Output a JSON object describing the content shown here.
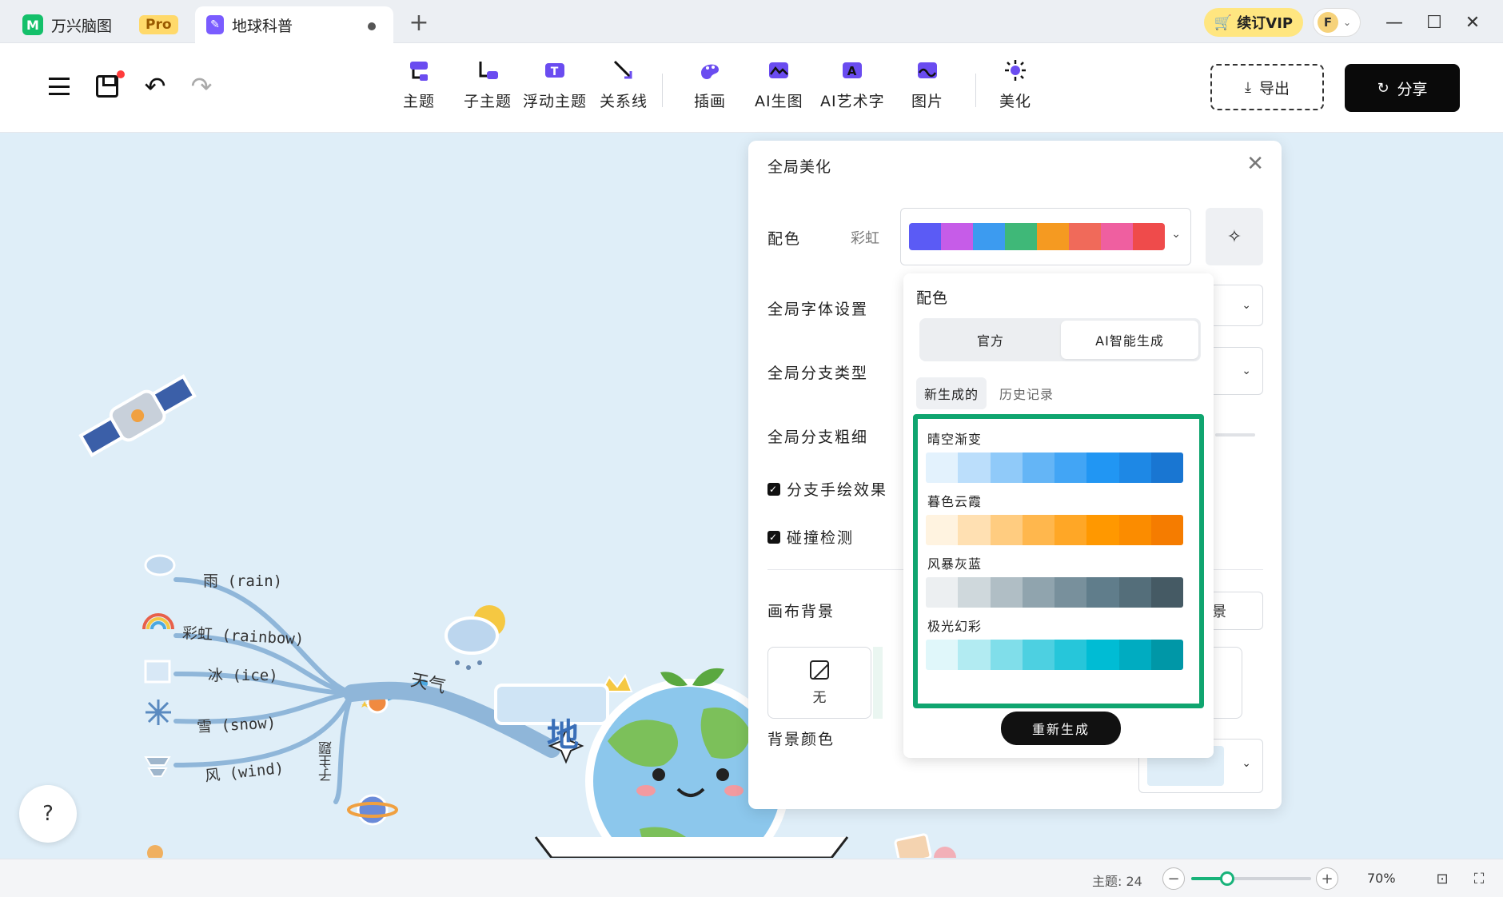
{
  "titlebar": {
    "app_name": "万兴脑图",
    "pro_badge": "Pro",
    "doc_tab": "地球科普",
    "vip_button": "续订VIP",
    "avatar_letter": "F"
  },
  "toolbar": {
    "tools": [
      {
        "label": "主题",
        "icon": "topic-icon"
      },
      {
        "label": "子主题",
        "icon": "subtopic-icon"
      },
      {
        "label": "浮动主题",
        "icon": "floating-topic-icon"
      },
      {
        "label": "关系线",
        "icon": "relation-line-icon"
      },
      {
        "label": "插画",
        "icon": "illustration-icon"
      },
      {
        "label": "AI生图",
        "icon": "ai-image-icon"
      },
      {
        "label": "AI艺术字",
        "icon": "ai-art-text-icon"
      },
      {
        "label": "图片",
        "icon": "picture-icon"
      },
      {
        "label": "美化",
        "icon": "beautify-icon"
      }
    ],
    "export_label": "导出",
    "share_label": "分享"
  },
  "mindmap": {
    "central": "地",
    "weather_branch": "天气",
    "subtopic_label": "子主题",
    "leaves": [
      "雨 (rain)",
      "彩虹 (rainbow)",
      "冰 (ice)",
      "雪 (snow)",
      "风 (wind)"
    ]
  },
  "panel": {
    "title": "全局美化",
    "color_label": "配色",
    "scheme_name": "彩虹",
    "scheme_colors": [
      "#5b5bf5",
      "#c65ce8",
      "#3c9bf0",
      "#3fb878",
      "#f59a21",
      "#f06a5a",
      "#ef5fa0",
      "#ef4b4b"
    ],
    "font_label": "全局字体设置",
    "branch_type_label": "全局分支类型",
    "branch_width_label": "全局分支粗细",
    "hand_drawn_label": "分支手绘效果",
    "collision_label": "碰撞检测",
    "canvas_bg_label": "画布背景",
    "canvas_bg_suffix": "景",
    "none_label": "无",
    "bg_color_label": "背景颜色",
    "bg_color_value": "#dfeef8"
  },
  "popup": {
    "title": "配色",
    "seg_official": "官方",
    "seg_ai": "AI智能生成",
    "subtab_new": "新生成的",
    "subtab_history": "历史记录",
    "palettes": [
      {
        "name": "晴空渐变",
        "colors": [
          "#e3f2fd",
          "#bbdefb",
          "#90caf9",
          "#64b5f6",
          "#42a5f5",
          "#2196f3",
          "#1e88e5",
          "#1976d2"
        ]
      },
      {
        "name": "暮色云霞",
        "colors": [
          "#fff3e0",
          "#ffe0b2",
          "#ffcc80",
          "#ffb74d",
          "#ffa726",
          "#ff9800",
          "#fb8c00",
          "#f57c00"
        ]
      },
      {
        "name": "风暴灰蓝",
        "colors": [
          "#eceff1",
          "#cfd8dc",
          "#b0bec5",
          "#90a4ae",
          "#78909c",
          "#607d8b",
          "#546e7a",
          "#455a64"
        ]
      },
      {
        "name": "极光幻彩",
        "colors": [
          "#e0f7fa",
          "#b2ebf2",
          "#80deea",
          "#4dd0e1",
          "#26c6da",
          "#00bcd4",
          "#00acc1",
          "#0097a7"
        ]
      }
    ],
    "regen_label": "重新生成"
  },
  "statusbar": {
    "topic_count": "主题: 24",
    "zoom": "70%",
    "zoom_level": 0.3
  }
}
